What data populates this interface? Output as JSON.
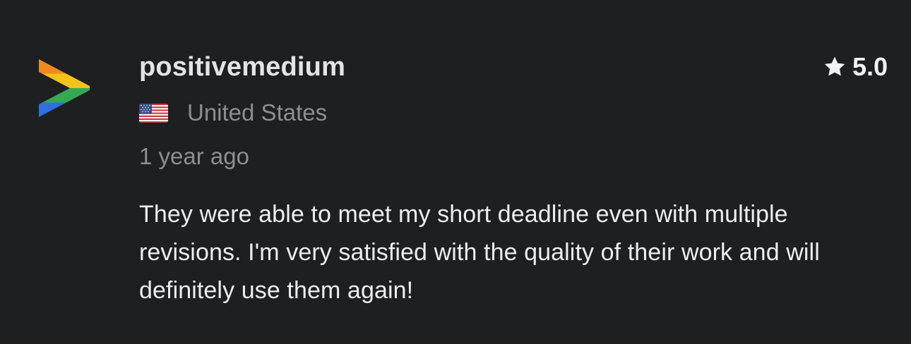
{
  "review": {
    "username": "positivemedium",
    "rating": "5.0",
    "country": "United States",
    "country_flag_icon": "us-flag-icon",
    "time_ago": "1 year ago",
    "text": "They were able to meet my short deadline even with multiple revisions. I'm very satisfied with the quality of their work and will definitely use them again!",
    "avatar_icon": "rainbow-chevron-avatar-icon",
    "rating_icon": "star-icon"
  },
  "colors": {
    "background": "#1e1f21",
    "text_primary": "#e9e9ea",
    "text_secondary": "#8d8e92",
    "avatar_stripes": [
      "#f08a1c",
      "#f2c318",
      "#34a853",
      "#2f6fe0"
    ]
  }
}
